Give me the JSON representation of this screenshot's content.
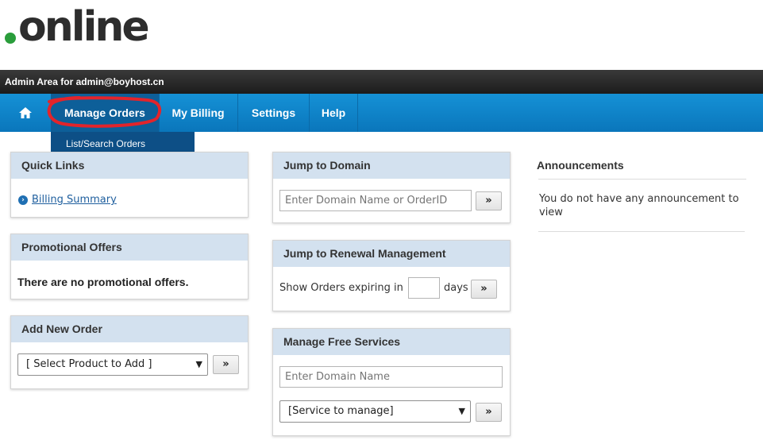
{
  "logo": {
    "text": "online",
    "dot_color": "#2a9d3b"
  },
  "topbar": {
    "text": "Admin Area for admin@boyhost.cn"
  },
  "nav": {
    "home_icon": "home-icon",
    "items": [
      {
        "label": "Manage Orders"
      },
      {
        "label": "My Billing"
      },
      {
        "label": "Settings"
      },
      {
        "label": "Help"
      }
    ]
  },
  "dropdown": {
    "items": [
      {
        "label": "List/Search Orders"
      }
    ]
  },
  "quick_links": {
    "title": "Quick Links",
    "link": "Billing Summary",
    "icon": "arrow-circle-icon"
  },
  "promotional": {
    "title": "Promotional Offers",
    "message": "There are no promotional offers."
  },
  "add_order": {
    "title": "Add New Order",
    "select_value": "[ Select Product to Add ]",
    "go_label": "»"
  },
  "jump_domain": {
    "title": "Jump to Domain",
    "placeholder": "Enter Domain Name or OrderID",
    "go_label": "»"
  },
  "renewal": {
    "title": "Jump to Renewal Management",
    "prefix": "Show Orders expiring in",
    "value": "",
    "suffix": "days",
    "go_label": "»"
  },
  "free_services": {
    "title": "Manage Free Services",
    "placeholder": "Enter Domain Name",
    "select_value": "[Service to manage]",
    "go_label": "»"
  },
  "announcements": {
    "title": "Announcements",
    "message": "You do not have any announcement to view"
  },
  "colors": {
    "nav_blue": "#0a76bb",
    "nav_active": "#0d5f99",
    "panel_head": "#d3e1ef",
    "annotation_red": "#e3242b"
  }
}
